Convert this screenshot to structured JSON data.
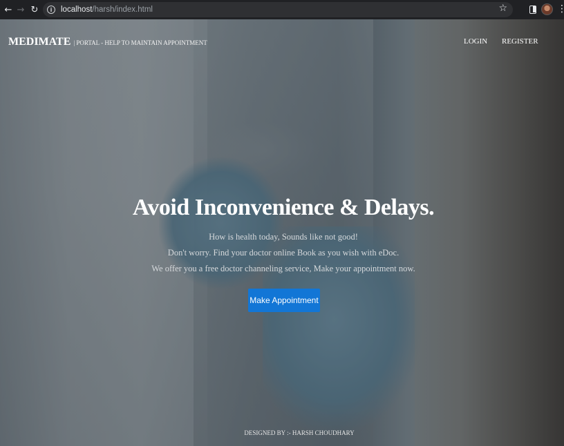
{
  "browser": {
    "url_host": "localhost",
    "url_path": "/harsh/index.html"
  },
  "header": {
    "brand_name": "MEDIMATE",
    "brand_tagline": "| PORTAL - HELP TO MAINTAIN APPOINTMENT",
    "nav": [
      {
        "label": "LOGIN"
      },
      {
        "label": "REGISTER"
      }
    ]
  },
  "hero": {
    "headline": "Avoid Inconvenience & Delays.",
    "lines": [
      "How is health today, Sounds like not good!",
      "Don't worry. Find your doctor online Book as you wish with eDoc.",
      "We offer you a free doctor channeling service, Make your appointment now."
    ],
    "cta_label": "Make Appointment"
  },
  "footer": {
    "credit": "DESIGNED BY :- HARSH CHOUDHARY"
  },
  "colors": {
    "cta": "#1276d6",
    "browser_bar": "#202124"
  }
}
